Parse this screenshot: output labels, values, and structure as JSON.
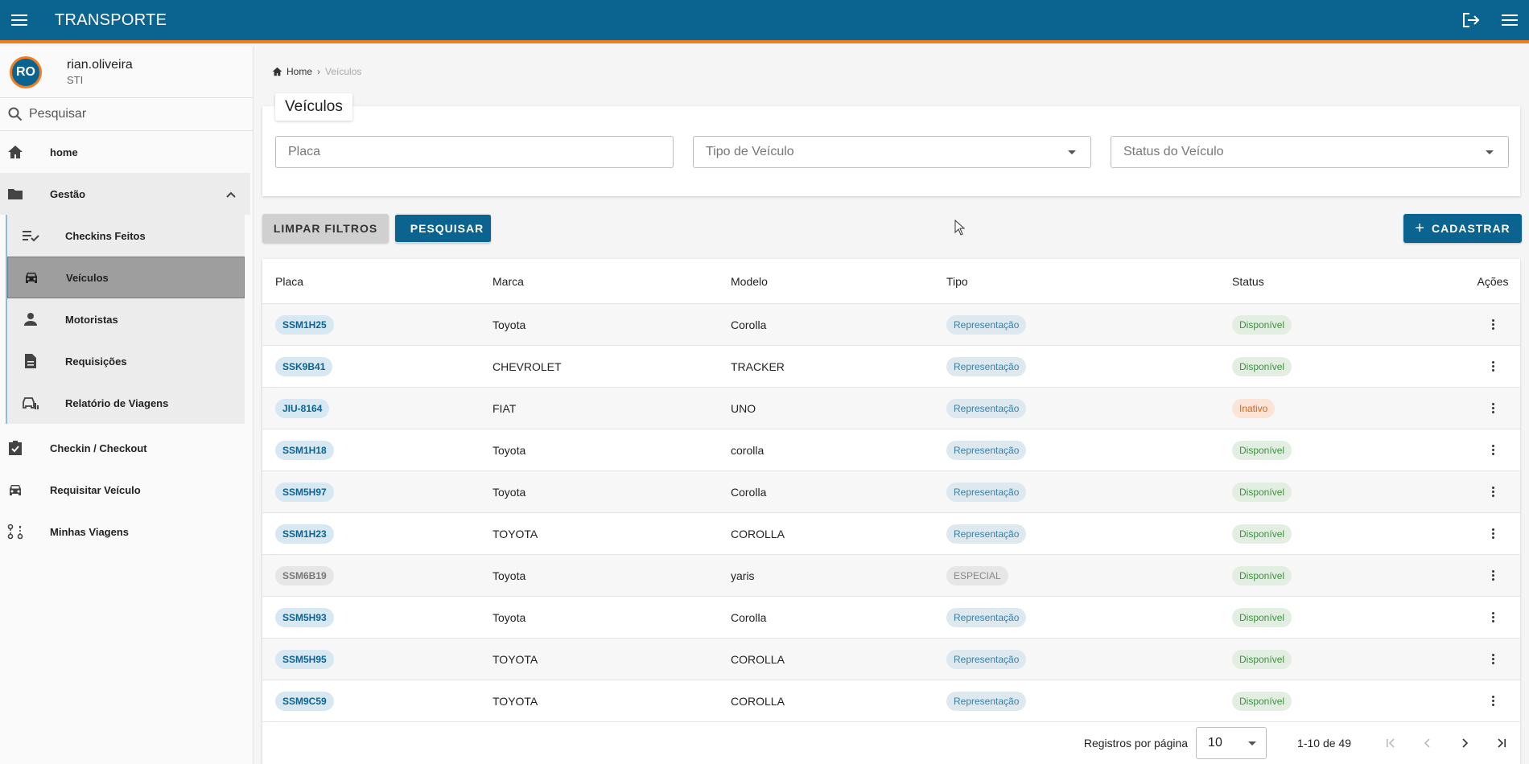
{
  "app": {
    "title": "TRANSPORTE"
  },
  "user": {
    "initials": "RO",
    "name": "rian.oliveira",
    "dept": "STI"
  },
  "search": {
    "placeholder": "Pesquisar"
  },
  "nav": {
    "home": "home",
    "gestao": "Gestão",
    "sub": [
      "Checkins Feitos",
      "Veículos",
      "Motoristas",
      "Requisições",
      "Relatório de Viagens"
    ],
    "checkin": "Checkin / Checkout",
    "requisitar": "Requisitar Veículo",
    "viagens": "Minhas Viagens"
  },
  "breadcrumb": {
    "home": "Home",
    "current": "Veículos"
  },
  "page": {
    "title": "Veículos"
  },
  "filters": {
    "placa": "Placa",
    "tipo": "Tipo de Veículo",
    "status": "Status do Veículo"
  },
  "buttons": {
    "clear": "LIMPAR FILTROS",
    "search": "PESQUISAR",
    "add": "CADASTRAR"
  },
  "table": {
    "headers": [
      "Placa",
      "Marca",
      "Modelo",
      "Tipo",
      "Status",
      "Ações"
    ],
    "rows": [
      {
        "placa": "SSM1H25",
        "marca": "Toyota",
        "modelo": "Corolla",
        "tipo": "Representação",
        "status": "Disponível"
      },
      {
        "placa": "SSK9B41",
        "marca": "CHEVROLET",
        "modelo": "TRACKER",
        "tipo": "Representação",
        "status": "Disponível"
      },
      {
        "placa": "JIU-8164",
        "marca": "FIAT",
        "modelo": "UNO",
        "tipo": "Representação",
        "status": "Inativo"
      },
      {
        "placa": "SSM1H18",
        "marca": "Toyota",
        "modelo": "corolla",
        "tipo": "Representação",
        "status": "Disponível"
      },
      {
        "placa": "SSM5H97",
        "marca": "Toyota",
        "modelo": "Corolla",
        "tipo": "Representação",
        "status": "Disponível"
      },
      {
        "placa": "SSM1H23",
        "marca": "TOYOTA",
        "modelo": "COROLLA",
        "tipo": "Representação",
        "status": "Disponível"
      },
      {
        "placa": "SSM6B19",
        "marca": "Toyota",
        "modelo": "yaris",
        "tipo": "ESPECIAL",
        "status": "Disponível"
      },
      {
        "placa": "SSM5H93",
        "marca": "Toyota",
        "modelo": "Corolla",
        "tipo": "Representação",
        "status": "Disponível"
      },
      {
        "placa": "SSM5H95",
        "marca": "TOYOTA",
        "modelo": "COROLLA",
        "tipo": "Representação",
        "status": "Disponível"
      },
      {
        "placa": "SSM9C59",
        "marca": "TOYOTA",
        "modelo": "COROLLA",
        "tipo": "Representação",
        "status": "Disponível"
      }
    ]
  },
  "pager": {
    "label": "Registros por página",
    "per_page": "10",
    "range": "1-10 de 49"
  },
  "colors": {
    "primary": "#0b6390",
    "accent": "#f47c20"
  }
}
